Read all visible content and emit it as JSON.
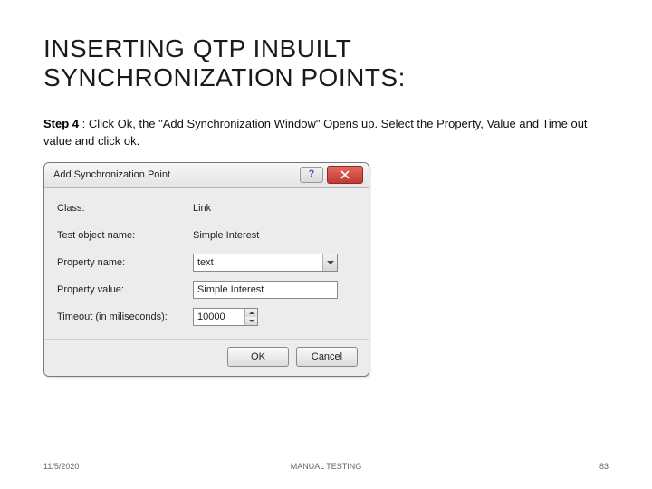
{
  "title": "INSERTING QTP INBUILT SYNCHRONIZATION POINTS:",
  "step": {
    "label": "Step 4",
    "text": " : Click Ok, the \"Add Synchronization Window\" Opens up. Select the Property, Value and Time out value and click ok."
  },
  "dialog": {
    "title": "Add Synchronization Point",
    "rows": {
      "class_label": "Class:",
      "class_value": "Link",
      "object_label": "Test object name:",
      "object_value": "Simple Interest",
      "prop_label": "Property name:",
      "prop_value": "text",
      "val_label": "Property value:",
      "val_value": "Simple Interest",
      "timeout_label": "Timeout (in miliseconds):",
      "timeout_value": "10000"
    },
    "buttons": {
      "ok": "OK",
      "cancel": "Cancel"
    }
  },
  "footer": {
    "date": "11/5/2020",
    "center": "MANUAL TESTING",
    "page": "83"
  }
}
